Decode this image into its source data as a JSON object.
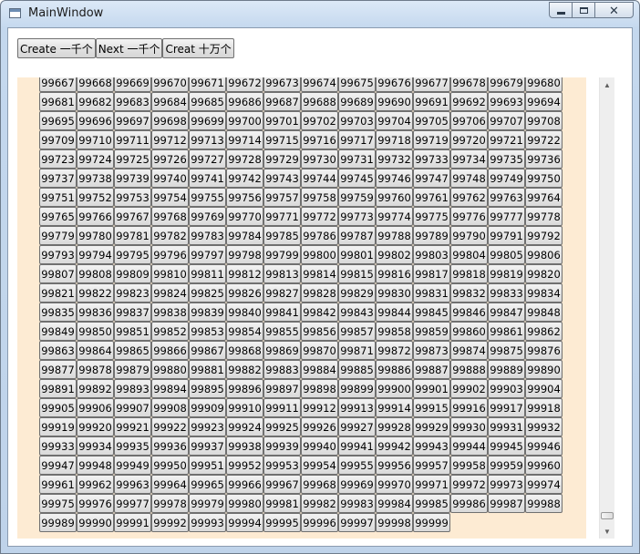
{
  "window": {
    "title": "MainWindow",
    "controls": {
      "minimize": "–",
      "maximize": "□",
      "close": "✕"
    }
  },
  "toolbar": {
    "create_1000_label": "Create 一千个",
    "next_1000_label": "Next 一千个",
    "create_100000_label": "Creat 十万个"
  },
  "grid": {
    "first_visible": 99681,
    "last_visible": 99999,
    "columns": 14
  },
  "scrollbar": {
    "up_icon": "chevron-up-icon",
    "down_icon": "chevron-down-icon",
    "position_fraction": 0.99
  },
  "colors": {
    "panel_background": "#fdebd3",
    "titlebar": "#c4d8ee"
  }
}
